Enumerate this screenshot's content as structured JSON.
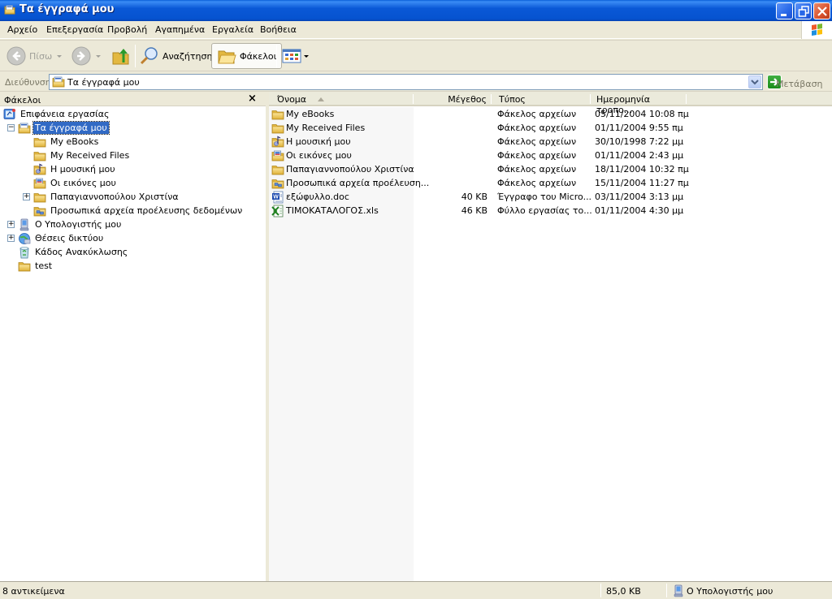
{
  "window": {
    "title": "Τα έγγραφά μου",
    "buttons": {
      "minimize": "minimize",
      "restore": "restore",
      "close": "close"
    }
  },
  "menu": [
    "Αρχείο",
    "Επεξεργασία",
    "Προβολή",
    "Αγαπημένα",
    "Εργαλεία",
    "Βοήθεια"
  ],
  "toolbar": {
    "back_label": "Πίσω",
    "search_label": "Αναζήτηση",
    "folders_label": "Φάκελοι"
  },
  "address": {
    "label": "Διεύθυνση",
    "value": "Τα έγγραφά μου",
    "go_label": "Μετάβαση"
  },
  "folder_pane": {
    "title": "Φάκελοι",
    "close_label": "×",
    "tree": [
      {
        "label": "Επιφάνεια εργασίας",
        "icon": "desktop-icon",
        "level": 0,
        "expander": ""
      },
      {
        "label": "Τα έγγραφά μου",
        "icon": "my-documents-icon",
        "level": 1,
        "expander": "−",
        "selected": true
      },
      {
        "label": "My eBooks",
        "icon": "folder-icon",
        "level": 2,
        "expander": ""
      },
      {
        "label": "My Received Files",
        "icon": "folder-icon",
        "level": 2,
        "expander": ""
      },
      {
        "label": "Η μουσική μου",
        "icon": "music-folder-icon",
        "level": 2,
        "expander": ""
      },
      {
        "label": "Οι εικόνες μου",
        "icon": "pictures-folder-icon",
        "level": 2,
        "expander": ""
      },
      {
        "label": "Παπαγιαννοπούλου Χριστίνα",
        "icon": "folder-icon",
        "level": 2,
        "expander": "+"
      },
      {
        "label": "Προσωπικά αρχεία προέλευσης δεδομένων",
        "icon": "data-sources-folder-icon",
        "level": 2,
        "expander": ""
      },
      {
        "label": "Ο Υπολογιστής μου",
        "icon": "my-computer-icon",
        "level": 1,
        "expander": "+"
      },
      {
        "label": "Θέσεις δικτύου",
        "icon": "network-places-icon",
        "level": 1,
        "expander": "+"
      },
      {
        "label": "Κάδος Ανακύκλωσης",
        "icon": "recycle-bin-icon",
        "level": 1,
        "expander": ""
      },
      {
        "label": "test",
        "icon": "folder-icon",
        "level": 1,
        "expander": ""
      }
    ]
  },
  "list": {
    "columns": [
      "Όνομα",
      "Μέγεθος",
      "Τύπος",
      "Ημερομηνία τροπο..."
    ],
    "sorted_by": "Όνομα",
    "rows": [
      {
        "name": "My eBooks",
        "size": "",
        "type": "Φάκελος αρχείων",
        "date": "05/11/2004 10:08 πμ",
        "icon": "folder-icon"
      },
      {
        "name": "My Received Files",
        "size": "",
        "type": "Φάκελος αρχείων",
        "date": "01/11/2004 9:55 πμ",
        "icon": "folder-icon"
      },
      {
        "name": "Η μουσική μου",
        "size": "",
        "type": "Φάκελος αρχείων",
        "date": "30/10/1998 7:22 μμ",
        "icon": "music-folder-icon"
      },
      {
        "name": "Οι εικόνες μου",
        "size": "",
        "type": "Φάκελος αρχείων",
        "date": "01/11/2004 2:43 μμ",
        "icon": "pictures-folder-icon"
      },
      {
        "name": "Παπαγιαννοπούλου Χριστίνα",
        "size": "",
        "type": "Φάκελος αρχείων",
        "date": "18/11/2004 10:32 πμ",
        "icon": "folder-icon"
      },
      {
        "name": "Προσωπικά αρχεία προέλευση...",
        "size": "",
        "type": "Φάκελος αρχείων",
        "date": "15/11/2004 11:27 πμ",
        "icon": "data-sources-folder-icon"
      },
      {
        "name": "εξώφυλλο.doc",
        "size": "40 KB",
        "type": "Έγγραφο του Micro...",
        "date": "03/11/2004 3:13 μμ",
        "icon": "word-doc-icon"
      },
      {
        "name": "ΤΙΜΟΚΑΤΑΛΟΓΟΣ.xls",
        "size": "46 KB",
        "type": "Φύλλο εργασίας το...",
        "date": "01/11/2004 4:30 μμ",
        "icon": "excel-sheet-icon"
      }
    ]
  },
  "status": {
    "items": "8 αντικείμενα",
    "size": "85,0 KB",
    "location": "Ο Υπολογιστής μου"
  }
}
